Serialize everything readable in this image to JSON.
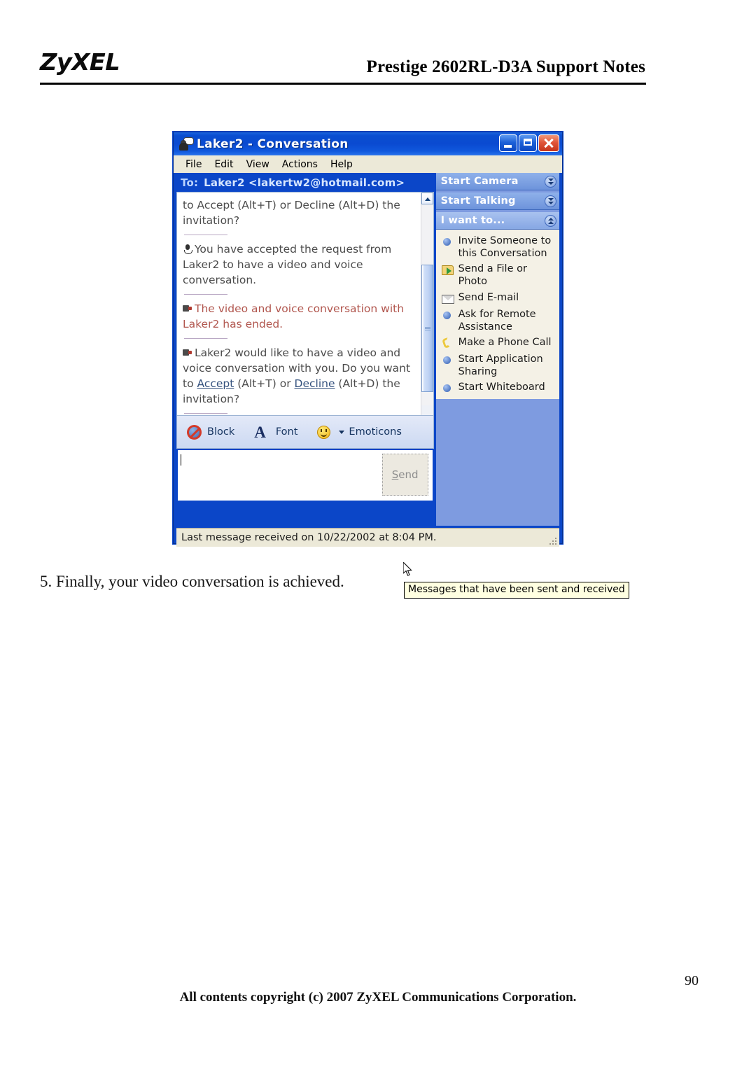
{
  "page": {
    "logo": "ZyXEL",
    "header_title": "Prestige 2602RL-D3A Support Notes",
    "caption": "5. Finally, your video conversation is achieved.",
    "page_number": "90",
    "footer": "All contents copyright (c) 2007 ZyXEL Communications Corporation.",
    "accent_blue": "#0b46c8",
    "titlebar_blue": "#0a4ad1",
    "sidebar_blue": "#7e9be0",
    "link_color": "#35527e",
    "alert_red": "#b1564e"
  },
  "window": {
    "title": "Laker2 - Conversation",
    "icon": "messenger-contact-icon",
    "controls": {
      "minimize": "Minimize",
      "maximize": "Maximize",
      "close": "Close"
    },
    "menu": [
      "File",
      "Edit",
      "View",
      "Actions",
      "Help"
    ],
    "to": {
      "label": "To:",
      "value": "Laker2 <lakertw2@hotmail.com>"
    },
    "messages": [
      {
        "id": "msg-invitation-prompt",
        "icon": null,
        "style": "gray",
        "text": "to Accept (Alt+T) or Decline (Alt+D) the invitation?"
      },
      {
        "id": "msg-accepted",
        "icon": "microphone-icon",
        "style": "gray",
        "text": "You have accepted the request from Laker2 to have a video and voice conversation."
      },
      {
        "id": "msg-ended",
        "icon": "video-ended-icon",
        "style": "red",
        "text": "The video and voice conversation with Laker2 has ended."
      },
      {
        "id": "msg-invite-request",
        "icon": "video-request-icon",
        "style": "gray",
        "text_part1": "Laker2 would like to have a video and voice conversation with you. Do you want to ",
        "link1": "Accept",
        "text_part2": " (Alt+T) or ",
        "link2": "Decline",
        "text_part3": " (Alt+D) the invitation?"
      }
    ],
    "tooltip": "Messages that have been sent and received",
    "toolbar": {
      "block": "Block",
      "font": "Font",
      "emoticons": "Emoticons"
    },
    "input": {
      "value": "",
      "placeholder": ""
    },
    "send_label_prefix": "S",
    "send_label_rest": "end",
    "statusbar": "Last message received on 10/22/2002 at 8:04 PM."
  },
  "sidebar": {
    "headers": [
      {
        "label": "Start Camera",
        "state": "collapsed"
      },
      {
        "label": "Start Talking",
        "state": "collapsed"
      },
      {
        "label": "I want to...",
        "state": "expanded"
      }
    ],
    "items": [
      {
        "label": "Invite Someone to this Conversation",
        "icon": "blue-dot-icon"
      },
      {
        "label": "Send a File or Photo",
        "icon": "folder-file-icon"
      },
      {
        "label": "Send E-mail",
        "icon": "envelope-icon"
      },
      {
        "label": "Ask for Remote Assistance",
        "icon": "blue-dot-icon"
      },
      {
        "label": "Make a Phone Call",
        "icon": "phone-icon"
      },
      {
        "label": "Start Application Sharing",
        "icon": "blue-dot-icon"
      },
      {
        "label": "Start Whiteboard",
        "icon": "blue-dot-icon"
      }
    ]
  }
}
